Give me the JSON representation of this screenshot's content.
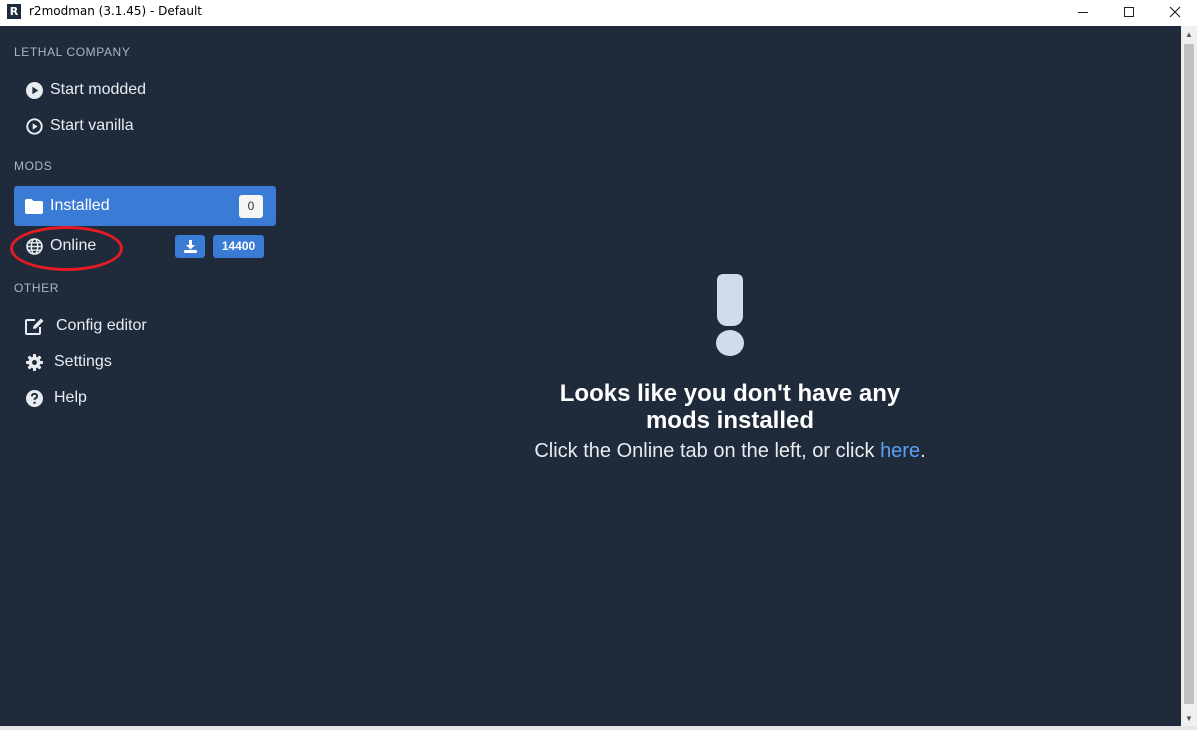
{
  "window": {
    "title": "r2modman (3.1.45) - Default",
    "logo_letter": "R"
  },
  "sidebar": {
    "sections": [
      {
        "label": "LETHAL COMPANY",
        "items": [
          {
            "label": "Start modded",
            "icon": "play-circle-icon"
          },
          {
            "label": "Start vanilla",
            "icon": "play-circle-outline-icon"
          }
        ]
      },
      {
        "label": "MODS",
        "items": [
          {
            "label": "Installed",
            "icon": "folder-icon",
            "active": true,
            "badge": "0"
          },
          {
            "label": "Online",
            "icon": "globe-icon",
            "badge": "14400",
            "download_icon": "download-icon"
          }
        ]
      },
      {
        "label": "OTHER",
        "items": [
          {
            "label": "Config editor",
            "icon": "edit-icon"
          },
          {
            "label": "Settings",
            "icon": "gear-icon"
          },
          {
            "label": "Help",
            "icon": "help-circle-icon"
          }
        ]
      }
    ]
  },
  "main": {
    "empty_heading": "Looks like you don't have any mods installed",
    "empty_sub_prefix": "Click the Online tab on the left, or click ",
    "empty_sub_link": "here",
    "empty_sub_suffix": "."
  },
  "colors": {
    "background": "#1f2b3b",
    "accent": "#3a7bd5",
    "annotation": "#e51b23",
    "link": "#5ba0f2"
  }
}
